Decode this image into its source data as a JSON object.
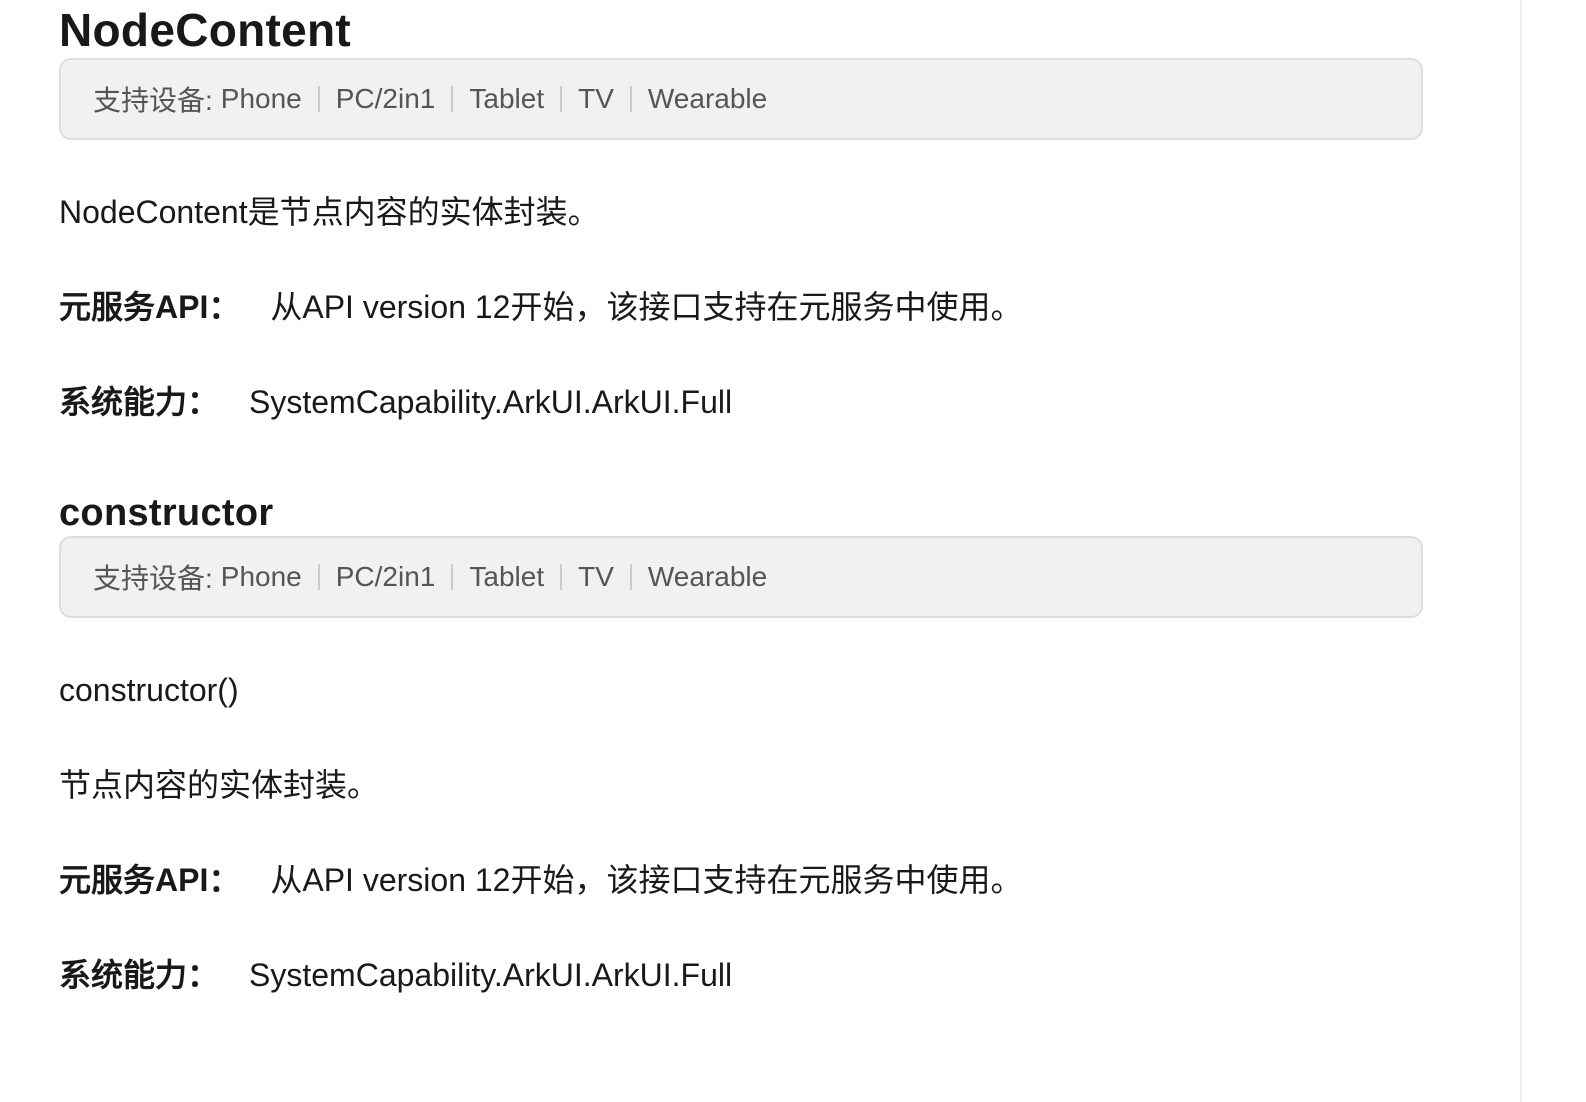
{
  "section1": {
    "title": "NodeContent",
    "devices_label": "支持设备: ",
    "devices": [
      "Phone",
      "PC/2in1",
      "Tablet",
      "TV",
      "Wearable"
    ],
    "description": "NodeContent是节点内容的实体封装。",
    "atomic_key": "元服务API：",
    "atomic_value": "从API version 12开始，该接口支持在元服务中使用。",
    "syscap_key": "系统能力：",
    "syscap_value": "SystemCapability.ArkUI.ArkUI.Full"
  },
  "section2": {
    "title": "constructor",
    "devices_label": "支持设备: ",
    "devices": [
      "Phone",
      "PC/2in1",
      "Tablet",
      "TV",
      "Wearable"
    ],
    "signature": "constructor()",
    "description": "节点内容的实体封装。",
    "atomic_key": "元服务API：",
    "atomic_value": "从API version 12开始，该接口支持在元服务中使用。",
    "syscap_key": "系统能力：",
    "syscap_value": "SystemCapability.ArkUI.ArkUI.Full"
  }
}
